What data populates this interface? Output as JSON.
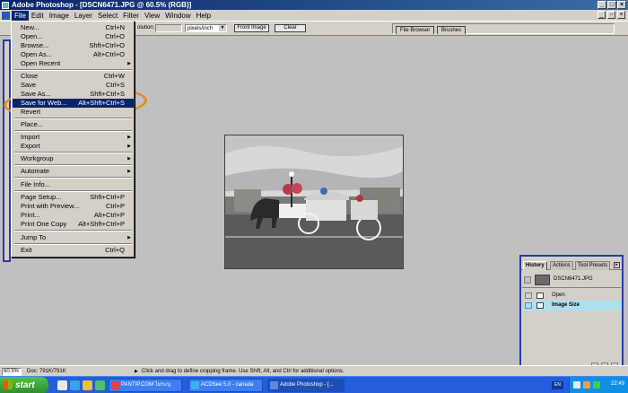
{
  "window": {
    "title": "Adobe Photoshop - [DSCN6471.JPG @ 60.5% (RGB)]"
  },
  "menubar": {
    "items": [
      "File",
      "Edit",
      "Image",
      "Layer",
      "Select",
      "Filter",
      "View",
      "Window",
      "Help"
    ],
    "active": "File"
  },
  "options_bar": {
    "resolution_label": "olution:",
    "units_select": "pixels/inch",
    "front_image_label": "Front Image",
    "clear_label": "Clear"
  },
  "palette_well": {
    "tabs": [
      "File Browser",
      "Brushes"
    ]
  },
  "file_menu": {
    "items": [
      {
        "label": "New...",
        "shortcut": "Ctrl+N"
      },
      {
        "label": "Open...",
        "shortcut": "Ctrl+O"
      },
      {
        "label": "Browse...",
        "shortcut": "Shft+Ctrl+O"
      },
      {
        "label": "Open As...",
        "shortcut": "Alt+Ctrl+O"
      },
      {
        "label": "Open Recent",
        "shortcut": ""
      },
      {
        "label": "Close",
        "shortcut": "Ctrl+W"
      },
      {
        "label": "Save",
        "shortcut": "Ctrl+S"
      },
      {
        "label": "Save As...",
        "shortcut": "Shft+Ctrl+S"
      },
      {
        "label": "Save for Web...",
        "shortcut": "Alt+Shft+Ctrl+S"
      },
      {
        "label": "Revert",
        "shortcut": ""
      },
      {
        "label": "Place...",
        "shortcut": ""
      },
      {
        "label": "Import",
        "shortcut": ""
      },
      {
        "label": "Export",
        "shortcut": ""
      },
      {
        "label": "Workgroup",
        "shortcut": ""
      },
      {
        "label": "Automate",
        "shortcut": ""
      },
      {
        "label": "File Info...",
        "shortcut": ""
      },
      {
        "label": "Page Setup...",
        "shortcut": "Shft+Ctrl+P"
      },
      {
        "label": "Print with Preview...",
        "shortcut": "Ctrl+P"
      },
      {
        "label": "Print...",
        "shortcut": "Alt+Ctrl+P"
      },
      {
        "label": "Print One Copy",
        "shortcut": "Alt+Shft+Ctrl+P"
      },
      {
        "label": "Jump To",
        "shortcut": ""
      },
      {
        "label": "Exit",
        "shortcut": "Ctrl+Q"
      }
    ],
    "highlighted": "Save for Web..."
  },
  "history_palette": {
    "tabs": [
      "History",
      "Actions",
      "Tool Presets"
    ],
    "snapshot": "DSCN6471.JPG",
    "states": [
      "Open",
      "Image Size"
    ],
    "selected_state": "Image Size"
  },
  "status_bar": {
    "zoom": "60.5%",
    "doc_size": "Doc: 791K/791K",
    "hint": "Click and drag to define cropping frame. Use Shift, Alt, and Ctrl for additional options."
  },
  "taskbar": {
    "start_label": "start",
    "tasks": [
      "PANTIP.COM ไม่ระบุ Blu...",
      "ACDSee 5.0 - canada",
      "Adobe Photoshop - [..."
    ],
    "active_task": "Adobe Photoshop - [...",
    "language": "EN",
    "clock": "22:49"
  },
  "colors": {
    "title_bar": "#0a246a",
    "highlight": "#0a246a",
    "annotation": "#e68a1f",
    "history_selected": "#aedff0",
    "taskbar": "#245edb"
  }
}
